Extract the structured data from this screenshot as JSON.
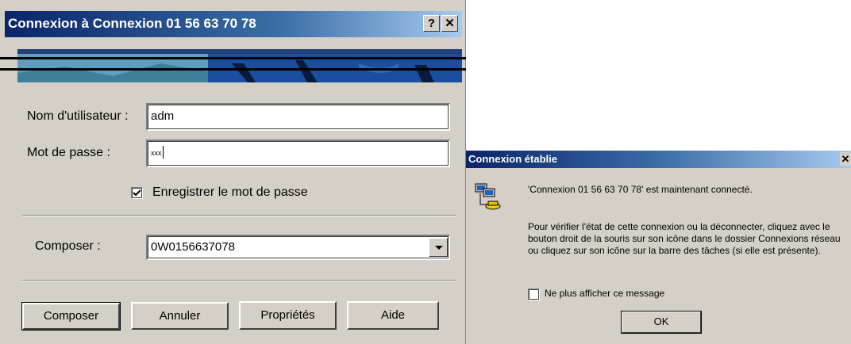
{
  "dial_dialog": {
    "title": "Connexion à Connexion 01 56 63 70 78",
    "help_button": "?",
    "close_button": "✕",
    "username_label": "Nom d'utilisateur :",
    "username_value": "adm",
    "password_label": "Mot de passe :",
    "password_value": "xxx",
    "save_password_label": "Enregistrer le mot de passe",
    "save_password_checked": true,
    "dial_label": "Composer :",
    "dial_value": "0W0156637078",
    "buttons": {
      "dial": "Composer",
      "cancel": "Annuler",
      "properties": "Propriétés",
      "help": "Aide"
    }
  },
  "connected_dialog": {
    "title": "Connexion établie",
    "close_button": "✕",
    "status_message": "'Connexion 01 56 63 70 78' est maintenant connecté.",
    "info_message": "Pour vérifier l'état de cette connexion ou la déconnecter, cliquez avec le bouton droit de la souris sur son icône dans le dossier Connexions réseau ou cliquez sur son icône sur la barre des tâches (si elle est présente).",
    "dont_show_label": "Ne plus afficher ce message",
    "dont_show_checked": false,
    "ok_button": "OK"
  },
  "colors": {
    "titlebar": "#0a246a",
    "dialog_face": "#d4d0c8"
  }
}
